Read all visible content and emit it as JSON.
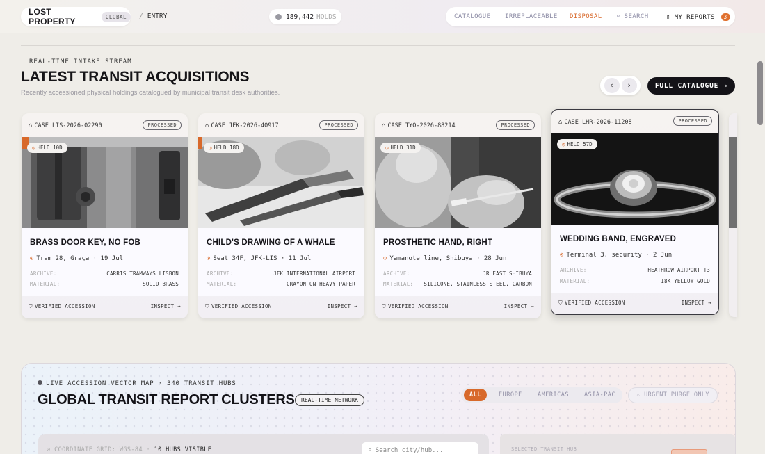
{
  "header": {
    "brand": "LOST PROPERTY",
    "brand_tag": "GLOBAL",
    "crumb_sep": "/",
    "crumb": "ENTRY",
    "holds_count": "189,442",
    "holds_label": "HOLDS",
    "nav": {
      "catalogue": "CATALOGUE",
      "irreplaceable": "IRREPLACEABLE",
      "disposal": "DISPOSAL",
      "search": "SEARCH",
      "reports": "MY REPORTS",
      "reports_count": "3"
    }
  },
  "section": {
    "eyebrow": "REAL-TIME INTAKE STREAM",
    "title": "LATEST TRANSIT ACQUISITIONS",
    "subtitle": "Recently accessioned physical holdings catalogued by municipal transit desk authorities.",
    "prev": "‹",
    "next": "›",
    "full_catalogue": "FULL CATALOGUE →"
  },
  "cards": [
    {
      "case": "CASE LIS-2026-02290",
      "status": "PROCESSED",
      "held": "HELD 10D",
      "title": "BRASS DOOR KEY, NO FOB",
      "location": "Tram 28, Graça · 19 Jul",
      "archive_label": "ARCHIVE:",
      "archive": "CARRIS TRAMWAYS LISBON",
      "material_label": "MATERIAL:",
      "material": "SOLID BRASS",
      "verified": "VERIFIED ACCESSION",
      "inspect": "INSPECT →"
    },
    {
      "case": "CASE JFK-2026-40917",
      "status": "PROCESSED",
      "held": "HELD 18D",
      "title": "CHILD'S DRAWING OF A WHALE",
      "location": "Seat 34F, JFK-LIS · 11 Jul",
      "archive_label": "ARCHIVE:",
      "archive": "JFK INTERNATIONAL AIRPORT",
      "material_label": "MATERIAL:",
      "material": "CRAYON ON HEAVY PAPER",
      "verified": "VERIFIED ACCESSION",
      "inspect": "INSPECT →"
    },
    {
      "case": "CASE TYO-2026-88214",
      "status": "PROCESSED",
      "held": "HELD 31D",
      "title": "PROSTHETIC HAND, RIGHT",
      "location": "Yamanote line, Shibuya · 28 Jun",
      "archive_label": "ARCHIVE:",
      "archive": "JR EAST SHIBUYA",
      "material_label": "MATERIAL:",
      "material": "SILICONE, STAINLESS STEEL, CARBON",
      "verified": "VERIFIED ACCESSION",
      "inspect": "INSPECT →"
    },
    {
      "case": "CASE LHR-2026-11208",
      "status": "PROCESSED",
      "held": "HELD 57D",
      "title": "WEDDING BAND, ENGRAVED",
      "location": "Terminal 3, security · 2 Jun",
      "archive_label": "ARCHIVE:",
      "archive": "HEATHROW AIRPORT T3",
      "material_label": "MATERIAL:",
      "material": "18K YELLOW GOLD",
      "verified": "VERIFIED ACCESSION",
      "inspect": "INSPECT →"
    }
  ],
  "map": {
    "live": "LIVE ACCESSION VECTOR MAP · 340 TRANSIT HUBS",
    "title": "GLOBAL TRANSIT REPORT CLUSTERS",
    "badge": "REAL-TIME NETWORK",
    "filters": [
      "ALL",
      "EUROPE",
      "AMERICAS",
      "ASIA-PAC"
    ],
    "urgent": "URGENT PURGE ONLY",
    "coord_label": "COORDINATE GRID: WGS-84",
    "coord_sep": "·",
    "hubs_visible": "10 HUBS VISIBLE",
    "search_placeholder": "Search city/hub...",
    "selected_label": "SELECTED TRANSIT HUB"
  },
  "colors": {
    "accent": "#d8692b",
    "dark": "#141318"
  }
}
